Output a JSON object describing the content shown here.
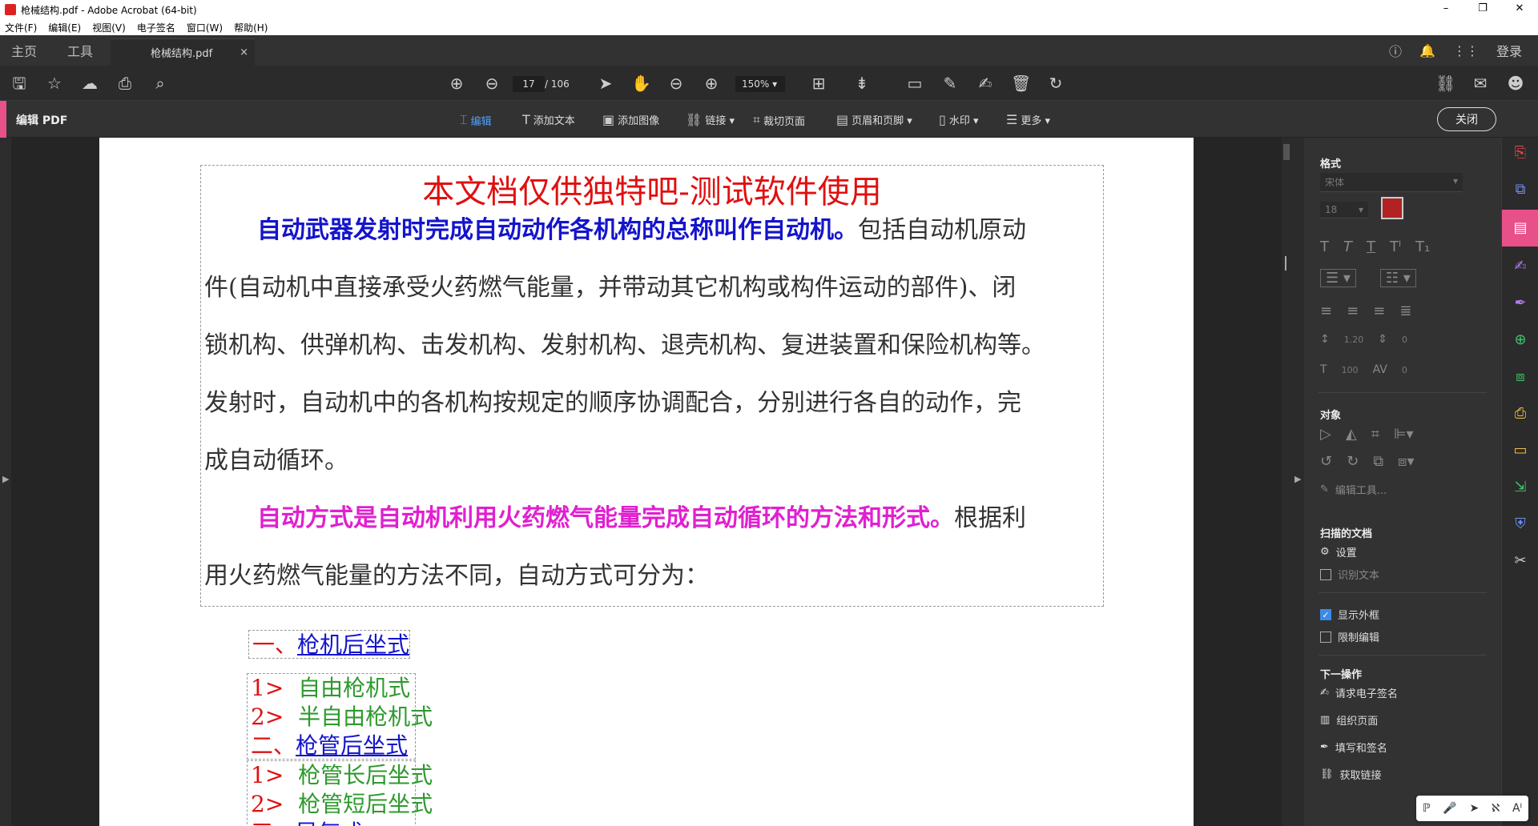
{
  "window": {
    "title": "枪械结构.pdf - Adobe Acrobat (64-bit)",
    "min": "–",
    "max": "❐",
    "close": "✕"
  },
  "menu": [
    "文件(F)",
    "编辑(E)",
    "视图(V)",
    "电子签名",
    "窗口(W)",
    "帮助(H)"
  ],
  "nav": {
    "home": "主页",
    "tools": "工具",
    "doc_tab": "枪械结构.pdf",
    "tab_close": "×",
    "login": "登录"
  },
  "toolbar": {
    "page_current": "17",
    "page_total": "/ 106",
    "zoom": "150%"
  },
  "editbar": {
    "title": "编辑 PDF",
    "tools": [
      {
        "label": "编辑",
        "icon": "edit-cursor-icon"
      },
      {
        "label": "添加文本",
        "icon": "text-icon"
      },
      {
        "label": "添加图像",
        "icon": "image-icon"
      },
      {
        "label": "链接 ▾",
        "icon": "link-icon"
      },
      {
        "label": "裁切页面",
        "icon": "crop-page-icon"
      },
      {
        "label": "页眉和页脚 ▾",
        "icon": "header-footer-icon"
      },
      {
        "label": "水印 ▾",
        "icon": "watermark-icon"
      },
      {
        "label": "更多 ▾",
        "icon": "more-icon"
      }
    ],
    "close": "关闭"
  },
  "document": {
    "title": "本文档仅供独特吧-测试软件使用",
    "p1_bold": "自动武器发射时完成自动动作各机构的总称叫作自动机。",
    "p1_line1_rest": "包括自动机原动",
    "p1_line2": "件(自动机中直接承受火药燃气能量，并带动其它机构或构件运动的部件)、闭",
    "p1_line3": "锁机构、供弹机构、击发机构、发射机构、退壳机构、复进装置和保险机构等。",
    "p1_line4": "发射时，自动机中的各机构按规定的顺序协调配合，分别进行各自的动作，完",
    "p1_line5": "成自动循环。",
    "p2_bold": "自动方式是自动机利用火药燃气能量完成自动循环的方法和形式。",
    "p2_line1_rest": "根据利",
    "p2_line2": "用火药燃气能量的方法不同，自动方式可分为：",
    "h1_num": "一、",
    "h1_text": "枪机后坐式",
    "l1_num": "1>",
    "l1_text": "自由枪机式",
    "l2_num": "2>",
    "l2_text": "半自由枪机式",
    "h2_num": "二、",
    "h2_text": "枪管后坐式",
    "l3_num": "1>",
    "l3_text": "枪管长后坐式",
    "l4_num": "2>",
    "l4_text": "枪管短后坐式",
    "h3_num": "三、",
    "h3_text": "导气式"
  },
  "panel": {
    "format": "格式",
    "font": "宋体",
    "font_size": "18",
    "line_spacing": "1.20",
    "para_spacing": "0",
    "scale": "100",
    "char_spacing": "0",
    "text_color": "#b22222",
    "object": "对象",
    "edit_tools": "编辑工具...",
    "scanned": "扫描的文档",
    "settings": "设置",
    "recognize": "识别文本",
    "show_box": "显示外框",
    "restrict": "限制编辑",
    "next": "下一操作",
    "next_items": [
      "请求电子签名",
      "组织页面",
      "填写和签名",
      "获取链接"
    ]
  },
  "ime": [
    "ℙ",
    "🎤",
    "➤",
    "ℵ",
    "Aᴵ"
  ]
}
